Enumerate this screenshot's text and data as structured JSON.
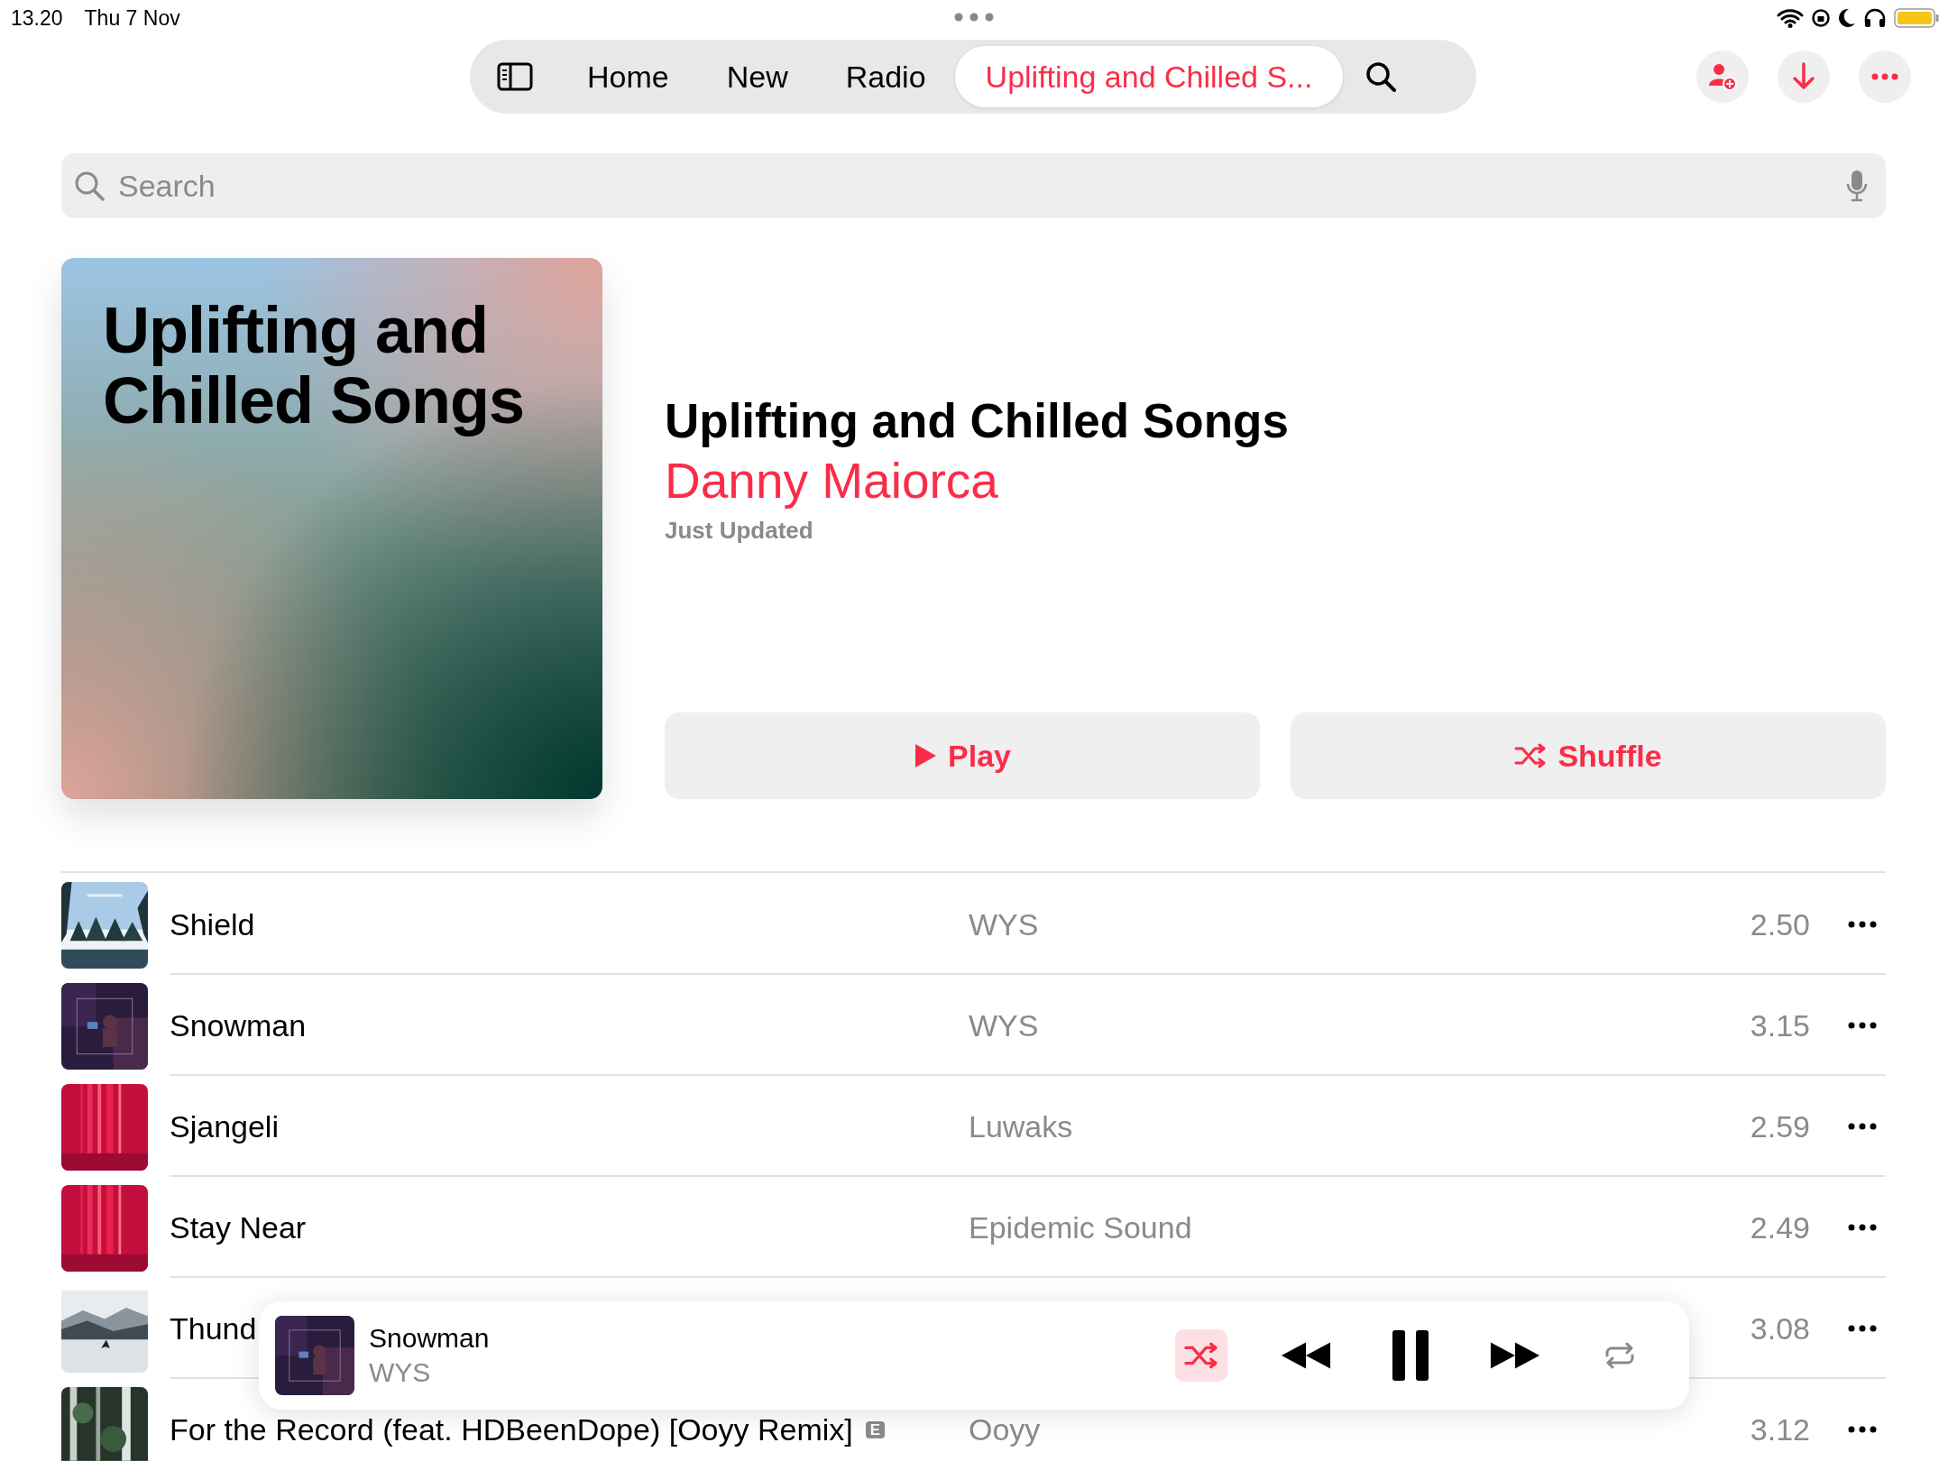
{
  "status_bar": {
    "time": "13.20",
    "date": "Thu 7 Nov"
  },
  "nav": {
    "tabs": [
      {
        "kind": "sidebar",
        "selected": false
      },
      {
        "kind": "label",
        "label": "Home",
        "selected": false
      },
      {
        "kind": "label",
        "label": "New",
        "selected": false
      },
      {
        "kind": "label",
        "label": "Radio",
        "selected": false
      },
      {
        "kind": "label",
        "label": "Uplifting and Chilled S...",
        "selected": true
      },
      {
        "kind": "search",
        "selected": false
      }
    ],
    "actions": [
      {
        "kind": "add-person"
      },
      {
        "kind": "download"
      },
      {
        "kind": "more"
      }
    ]
  },
  "search": {
    "placeholder": "Search"
  },
  "playlist": {
    "artwork": {
      "text": "Uplifting and Chilled Songs"
    },
    "title": "Uplifting and Chilled Songs",
    "curator": "Danny Maiorca",
    "updated": "Just Updated",
    "buttons": [
      {
        "kind": "play",
        "label": "Play"
      },
      {
        "kind": "shuffle",
        "label": "Shuffle"
      }
    ]
  },
  "tracks": [
    {
      "title": "Shield",
      "artist": "WYS",
      "duration": "2.50",
      "explicit": false
    },
    {
      "title": "Snowman",
      "artist": "WYS",
      "duration": "3.15",
      "explicit": false
    },
    {
      "title": "Sjangeli",
      "artist": "Luwaks",
      "duration": "2.59",
      "explicit": false
    },
    {
      "title": "Stay Near",
      "artist": "Epidemic Sound",
      "duration": "2.49",
      "explicit": false
    },
    {
      "title": "Thund",
      "duration": "3.08",
      "explicit": false
    },
    {
      "title": "For the Record (feat. HDBeenDope) [Ooyy Remix]",
      "artist": "Ooyy",
      "duration": "3.12",
      "explicit": true,
      "explicit_label": "E"
    }
  ],
  "now_playing": {
    "title": "Snowman",
    "artist": "WYS",
    "controls": [
      {
        "kind": "shuffle",
        "active": true
      },
      {
        "kind": "rewind",
        "active": false
      },
      {
        "kind": "pause",
        "active": false
      },
      {
        "kind": "forward",
        "active": false
      },
      {
        "kind": "repeat",
        "active": false
      }
    ]
  }
}
